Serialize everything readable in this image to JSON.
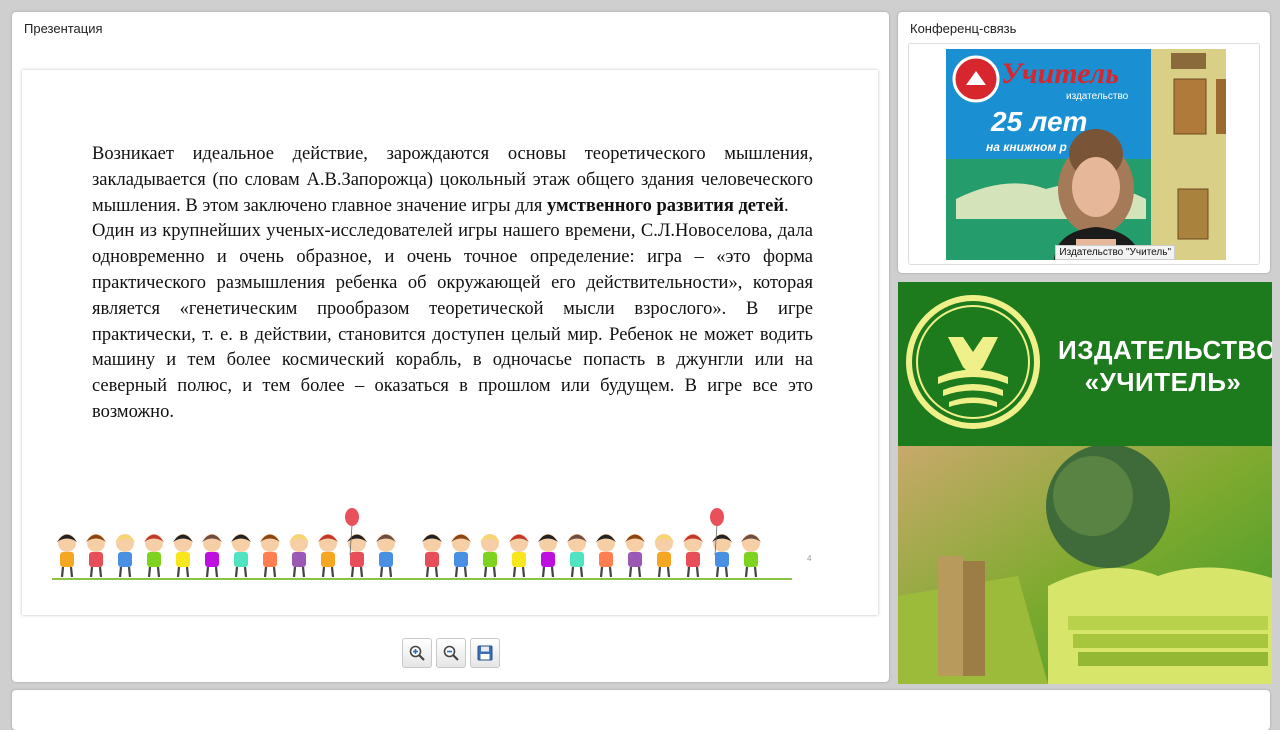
{
  "presentation": {
    "title": "Презентация",
    "slide": {
      "para1_pre": "Возникает идеальное действие, зарождаются основы теоретического мышления, закладывается (по словам А.В.Запорожца) цокольный этаж общего здания человеческого мышления. В этом заключено главное значение игры для ",
      "para1_bold": "умственного развития детей",
      "para1_post": ".",
      "para2": "Один из крупнейших ученых-исследователей игры нашего времени, С.Л.Новоселова, дала одновременно и очень образное, и очень точное определение: игра – «это форма практического размышления ребенка об окружающей его действительности», которая является «генетическим прообразом теоретической мысли взрослого». В игре практически, т. е. в действии, становится доступен целый мир. Ребенок не может водить машину и тем более космический корабль, в одночасье попасть в джунгли или на северный полюс, и тем более – оказаться в прошлом или будущем. В игре все это возможно.",
      "page_number": "4"
    },
    "toolbar": {
      "zoom_in_icon": "zoom-in-icon",
      "zoom_out_icon": "zoom-out-icon",
      "save_icon": "save-icon"
    }
  },
  "conference": {
    "title": "Конференц-связь",
    "video_label": "Издательство \"Учитель\"",
    "poster_brand": "Учитель",
    "poster_sub": "издательство",
    "poster_years": "25 лет",
    "poster_tagline": "на книжном р"
  },
  "banner": {
    "publisher_line1": "ИЗДАТЕЛЬСТВО",
    "publisher_line2": "«УЧИТЕЛЬ»"
  },
  "colors": {
    "banner_green": "#1d7a1d",
    "panel_bg": "#ffffff",
    "page_bg": "#cfcfcf"
  }
}
